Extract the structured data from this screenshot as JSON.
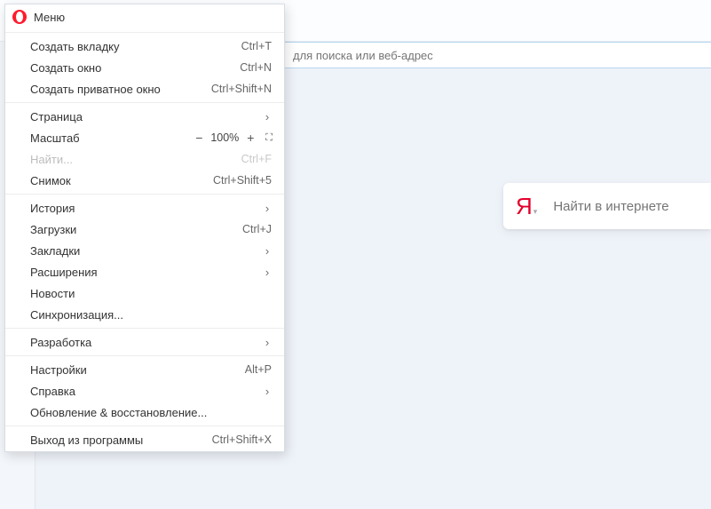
{
  "header": {
    "title": "Меню"
  },
  "address_bar": {
    "placeholder": "для поиска или веб-адрес"
  },
  "search_card": {
    "logo_letter": "Я",
    "placeholder": "Найти в интернете"
  },
  "menu": {
    "groups": [
      [
        {
          "label": "Создать вкладку",
          "shortcut": "Ctrl+T"
        },
        {
          "label": "Создать окно",
          "shortcut": "Ctrl+N"
        },
        {
          "label": "Создать приватное окно",
          "shortcut": "Ctrl+Shift+N"
        }
      ],
      [
        {
          "label": "Страница",
          "submenu": true
        },
        {
          "label": "Масштаб",
          "zoom": "100%"
        },
        {
          "label": "Найти...",
          "shortcut": "Ctrl+F",
          "disabled": true
        },
        {
          "label": "Снимок",
          "shortcut": "Ctrl+Shift+5"
        }
      ],
      [
        {
          "label": "История",
          "submenu": true
        },
        {
          "label": "Загрузки",
          "shortcut": "Ctrl+J"
        },
        {
          "label": "Закладки",
          "submenu": true
        },
        {
          "label": "Расширения",
          "submenu": true
        },
        {
          "label": "Новости"
        },
        {
          "label": "Синхронизация..."
        }
      ],
      [
        {
          "label": "Разработка",
          "submenu": true
        }
      ],
      [
        {
          "label": "Настройки",
          "shortcut": "Alt+P"
        },
        {
          "label": "Справка",
          "submenu": true
        },
        {
          "label": "Обновление & восстановление..."
        }
      ],
      [
        {
          "label": "Выход из программы",
          "shortcut": "Ctrl+Shift+X"
        }
      ]
    ]
  }
}
